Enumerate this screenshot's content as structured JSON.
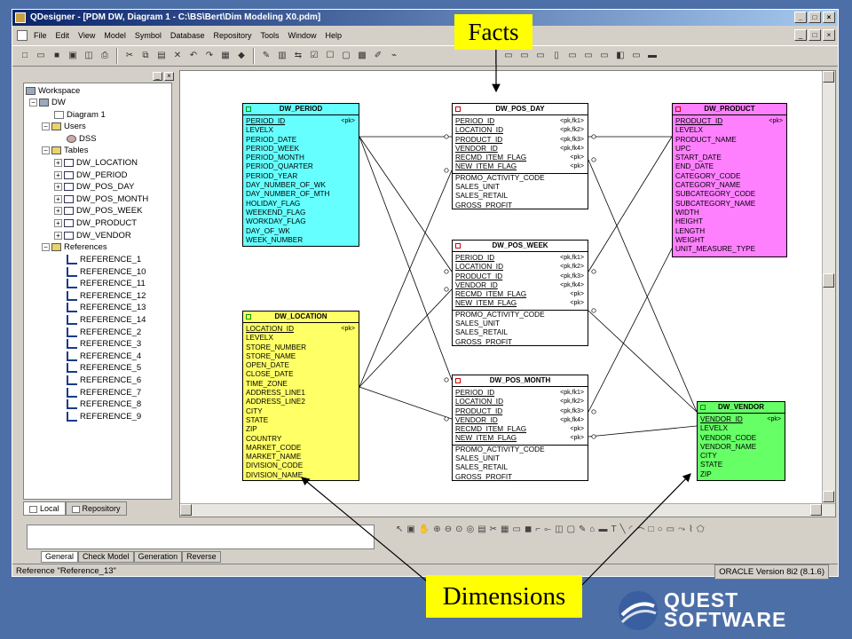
{
  "window": {
    "title": "QDesigner - [PDM DW, Diagram 1 - C:\\BS\\Bert\\Dim Modeling X0.pdm]",
    "win_buttons": [
      "_",
      "□",
      "×"
    ],
    "doc_buttons": [
      "_",
      "□",
      "×"
    ]
  },
  "menu": [
    "File",
    "Edit",
    "View",
    "Model",
    "Symbol",
    "Database",
    "Repository",
    "Tools",
    "Window",
    "Help"
  ],
  "browser": {
    "workspace": "Workspace",
    "model": "DW",
    "diagram": "Diagram 1",
    "users_folder": "Users",
    "user": "DSS",
    "tables_folder": "Tables",
    "tables": [
      "DW_LOCATION",
      "DW_PERIOD",
      "DW_POS_DAY",
      "DW_POS_MONTH",
      "DW_POS_WEEK",
      "DW_PRODUCT",
      "DW_VENDOR"
    ],
    "references_folder": "References",
    "references": [
      "REFERENCE_1",
      "REFERENCE_10",
      "REFERENCE_11",
      "REFERENCE_12",
      "REFERENCE_13",
      "REFERENCE_14",
      "REFERENCE_2",
      "REFERENCE_3",
      "REFERENCE_4",
      "REFERENCE_5",
      "REFERENCE_6",
      "REFERENCE_7",
      "REFERENCE_8",
      "REFERENCE_9"
    ],
    "tab_local": "Local",
    "tab_repository": "Repository"
  },
  "entities": {
    "period": {
      "name": "DW_PERIOD",
      "color": "#66ffff",
      "rows": [
        {
          "t": "PERIOD_ID",
          "k": "<pk>",
          "key": true
        },
        {
          "t": "LEVELX"
        },
        {
          "t": "PERIOD_DATE"
        },
        {
          "t": "PERIOD_WEEK"
        },
        {
          "t": "PERIOD_MONTH"
        },
        {
          "t": "PERIOD_QUARTER"
        },
        {
          "t": "PERIOD_YEAR"
        },
        {
          "t": "DAY_NUMBER_OF_WK"
        },
        {
          "t": "DAY_NUMBER_OF_MTH"
        },
        {
          "t": "HOLIDAY_FLAG"
        },
        {
          "t": "WEEKEND_FLAG"
        },
        {
          "t": "WORKDAY_FLAG"
        },
        {
          "t": "DAY_OF_WK"
        },
        {
          "t": "WEEK_NUMBER"
        }
      ]
    },
    "pos_day": {
      "name": "DW_POS_DAY",
      "color": "#ffffff",
      "rows": [
        {
          "t": "PERIOD_ID",
          "k": "<pk,fk1>",
          "key": true
        },
        {
          "t": "LOCATION_ID",
          "k": "<pk,fk2>",
          "key": true
        },
        {
          "t": "PRODUCT_ID",
          "k": "<pk,fk3>",
          "key": true
        },
        {
          "t": "VENDOR_ID",
          "k": "<pk,fk4>",
          "key": true
        },
        {
          "t": "RECMD_ITEM_FLAG",
          "k": "<pk>",
          "key": true
        },
        {
          "t": "NEW_ITEM_FLAG",
          "k": "<pk>",
          "key": true
        },
        {
          "t": "PROMO_ACTIVITY_CODE"
        },
        {
          "t": "SALES_UNIT"
        },
        {
          "t": "SALES_RETAIL"
        },
        {
          "t": "GROSS_PROFIT"
        }
      ]
    },
    "product": {
      "name": "DW_PRODUCT",
      "color": "#ff80ff",
      "rows": [
        {
          "t": "PRODUCT_ID",
          "k": "<pk>",
          "key": true
        },
        {
          "t": "LEVELX"
        },
        {
          "t": "PRODUCT_NAME"
        },
        {
          "t": "UPC"
        },
        {
          "t": "START_DATE"
        },
        {
          "t": "END_DATE"
        },
        {
          "t": "CATEGORY_CODE"
        },
        {
          "t": "CATEGORY_NAME"
        },
        {
          "t": "SUBCATEGORY_CODE"
        },
        {
          "t": "SUBCATEGORY_NAME"
        },
        {
          "t": "WIDTH"
        },
        {
          "t": "HEIGHT"
        },
        {
          "t": "LENGTH"
        },
        {
          "t": "WEIGHT"
        },
        {
          "t": "UNIT_MEASURE_TYPE"
        }
      ]
    },
    "pos_week": {
      "name": "DW_POS_WEEK",
      "color": "#ffffff",
      "rows": [
        {
          "t": "PERIOD_ID",
          "k": "<pk,fk1>",
          "key": true
        },
        {
          "t": "LOCATION_ID",
          "k": "<pk,fk2>",
          "key": true
        },
        {
          "t": "PRODUCT_ID",
          "k": "<pk,fk3>",
          "key": true
        },
        {
          "t": "VENDOR_ID",
          "k": "<pk,fk4>",
          "key": true
        },
        {
          "t": "RECMD_ITEM_FLAG",
          "k": "<pk>",
          "key": true
        },
        {
          "t": "NEW_ITEM_FLAG",
          "k": "<pk>",
          "key": true
        },
        {
          "t": "PROMO_ACTIVITY_CODE"
        },
        {
          "t": "SALES_UNIT"
        },
        {
          "t": "SALES_RETAIL"
        },
        {
          "t": "GROSS_PROFIT"
        }
      ]
    },
    "location": {
      "name": "DW_LOCATION",
      "color": "#ffff66",
      "rows": [
        {
          "t": "LOCATION_ID",
          "k": "<pk>",
          "key": true
        },
        {
          "t": "LEVELX"
        },
        {
          "t": "STORE_NUMBER"
        },
        {
          "t": "STORE_NAME"
        },
        {
          "t": "OPEN_DATE"
        },
        {
          "t": "CLOSE_DATE"
        },
        {
          "t": "TIME_ZONE"
        },
        {
          "t": "ADDRESS_LINE1"
        },
        {
          "t": "ADDRESS_LINE2"
        },
        {
          "t": "CITY"
        },
        {
          "t": "STATE"
        },
        {
          "t": "ZIP"
        },
        {
          "t": "COUNTRY"
        },
        {
          "t": "MARKET_CODE"
        },
        {
          "t": "MARKET_NAME"
        },
        {
          "t": "DIVISION_CODE"
        },
        {
          "t": "DIVISION_NAME"
        }
      ]
    },
    "pos_month": {
      "name": "DW_POS_MONTH",
      "color": "#ffffff",
      "rows": [
        {
          "t": "PERIOD_ID",
          "k": "<pk,fk1>",
          "key": true
        },
        {
          "t": "LOCATION_ID",
          "k": "<pk,fk2>",
          "key": true
        },
        {
          "t": "PRODUCT_ID",
          "k": "<pk,fk3>",
          "key": true
        },
        {
          "t": "VENDOR_ID",
          "k": "<pk,fk4>",
          "key": true
        },
        {
          "t": "RECMD_ITEM_FLAG",
          "k": "<pk>",
          "key": true
        },
        {
          "t": "NEW_ITEM_FLAG",
          "k": "<pk>",
          "key": true
        },
        {
          "t": "PROMO_ACTIVITY_CODE"
        },
        {
          "t": "SALES_UNIT"
        },
        {
          "t": "SALES_RETAIL"
        },
        {
          "t": "GROSS_PROFIT"
        }
      ]
    },
    "vendor": {
      "name": "DW_VENDOR",
      "color": "#66ff66",
      "rows": [
        {
          "t": "VENDOR_ID",
          "k": "<pk>",
          "key": true
        },
        {
          "t": "LEVELX"
        },
        {
          "t": "VENDOR_CODE"
        },
        {
          "t": "VENDOR_NAME"
        },
        {
          "t": "CITY"
        },
        {
          "t": "STATE"
        },
        {
          "t": "ZIP"
        }
      ]
    }
  },
  "output_tabs": [
    "General",
    "Check Model",
    "Generation",
    "Reverse"
  ],
  "status": {
    "left": "Reference \"Reference_13\"",
    "right": "ORACLE Version 8i2 (8.1.6)"
  },
  "callouts": {
    "facts": "Facts",
    "dimensions": "Dimensions"
  },
  "logo": {
    "line1": "QUEST",
    "line2": "SOFTWARE"
  }
}
